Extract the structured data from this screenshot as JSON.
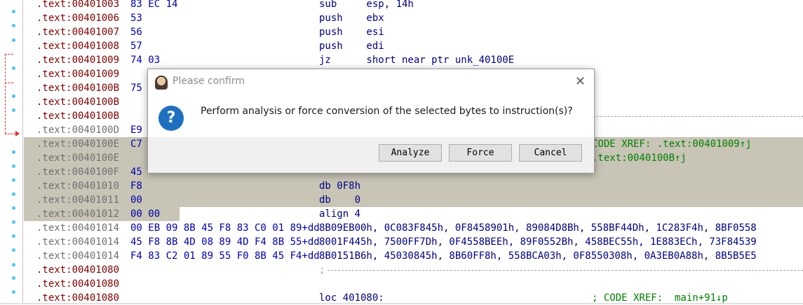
{
  "gutter_icons": [
    "breakpoint-dot-icon"
  ],
  "listing": [
    {
      "addr": ".text:00401003",
      "bytes": "83 EC 14",
      "code": "sub     esp, 14h",
      "comment": ""
    },
    {
      "addr": ".text:00401006",
      "bytes": "53",
      "code": "push    ebx",
      "comment": ""
    },
    {
      "addr": ".text:00401007",
      "bytes": "56",
      "code": "push    esi",
      "comment": ""
    },
    {
      "addr": ".text:00401008",
      "bytes": "57",
      "code": "push    edi",
      "comment": ""
    },
    {
      "addr": ".text:00401009",
      "bytes": "74 03",
      "code": "jz      short near ptr unk_40100E",
      "comment": ""
    },
    {
      "addr": ".text:00401009",
      "bytes": "",
      "code": "",
      "comment": ""
    },
    {
      "addr": ".text:0040100B",
      "bytes": "75",
      "code": "",
      "comment": ""
    },
    {
      "addr": ".text:0040100B",
      "bytes": "",
      "code": "",
      "comment": ""
    },
    {
      "addr": ".text:0040100B",
      "bytes": "",
      "code": "",
      "comment": ""
    },
    {
      "addr": ".text:0040100D",
      "bytes": "E9",
      "code": "",
      "comment": ""
    },
    {
      "addr": ".text:0040100E",
      "bytes": "C7",
      "code": "",
      "comment": "CODE XREF: .text:00401009↑j"
    },
    {
      "addr": ".text:0040100E",
      "bytes": "",
      "code": "",
      "comment": ".text:0040100B↑j"
    },
    {
      "addr": ".text:0040100F",
      "bytes": "45",
      "code": "",
      "comment": ""
    },
    {
      "addr": ".text:00401010",
      "bytes": "F8",
      "code": "db 0F8h",
      "comment": ""
    },
    {
      "addr": ".text:00401011",
      "bytes": "00",
      "code": "db    0",
      "comment": ""
    },
    {
      "addr": ".text:00401012",
      "bytes": "00 00",
      "code": "align 4",
      "comment": ""
    },
    {
      "addr": ".text:00401014",
      "bytes": "00 EB 09 8B 45 F8 83 C0 01 89+dd",
      "code": "8B09EB00h, 0C083F845h, 0F8458901h, 89084D8Bh, 558BF44Dh, 1C283F4h, 8BF0558",
      "comment": ""
    },
    {
      "addr": ".text:00401014",
      "bytes": "45 F8 8B 4D 08 89 4D F4 8B 55+dd",
      "code": "8001F445h, 7500FF7Dh, 0F4558BEEh, 89F0552Bh, 458BEC55h, 1E883ECh, 73F84539",
      "comment": ""
    },
    {
      "addr": ".text:00401014",
      "bytes": "F4 83 C2 01 89 55 F0 8B 45 F4+dd",
      "code": "8B0151B6h, 45030845h, 8B60FF8h, 558BCA03h, 0F8550308h, 0A3EB0A88h, 8B5B5E5",
      "comment": ""
    },
    {
      "addr": ".text:00401080",
      "bytes": "",
      "code": ";",
      "comment": ""
    },
    {
      "addr": ".text:00401080",
      "bytes": "",
      "code": "",
      "comment": ""
    },
    {
      "addr": ".text:00401080",
      "bytes": "",
      "code": "loc_401080:",
      "comment": "; CODE XREF: _main+91↓p"
    }
  ],
  "dialog": {
    "title": "Please confirm",
    "message": "Perform analysis or force conversion of the selected bytes to instruction(s)?",
    "icon": "question-icon",
    "buttons": {
      "analyze": "Analyze",
      "force": "Force",
      "cancel": "Cancel"
    }
  }
}
